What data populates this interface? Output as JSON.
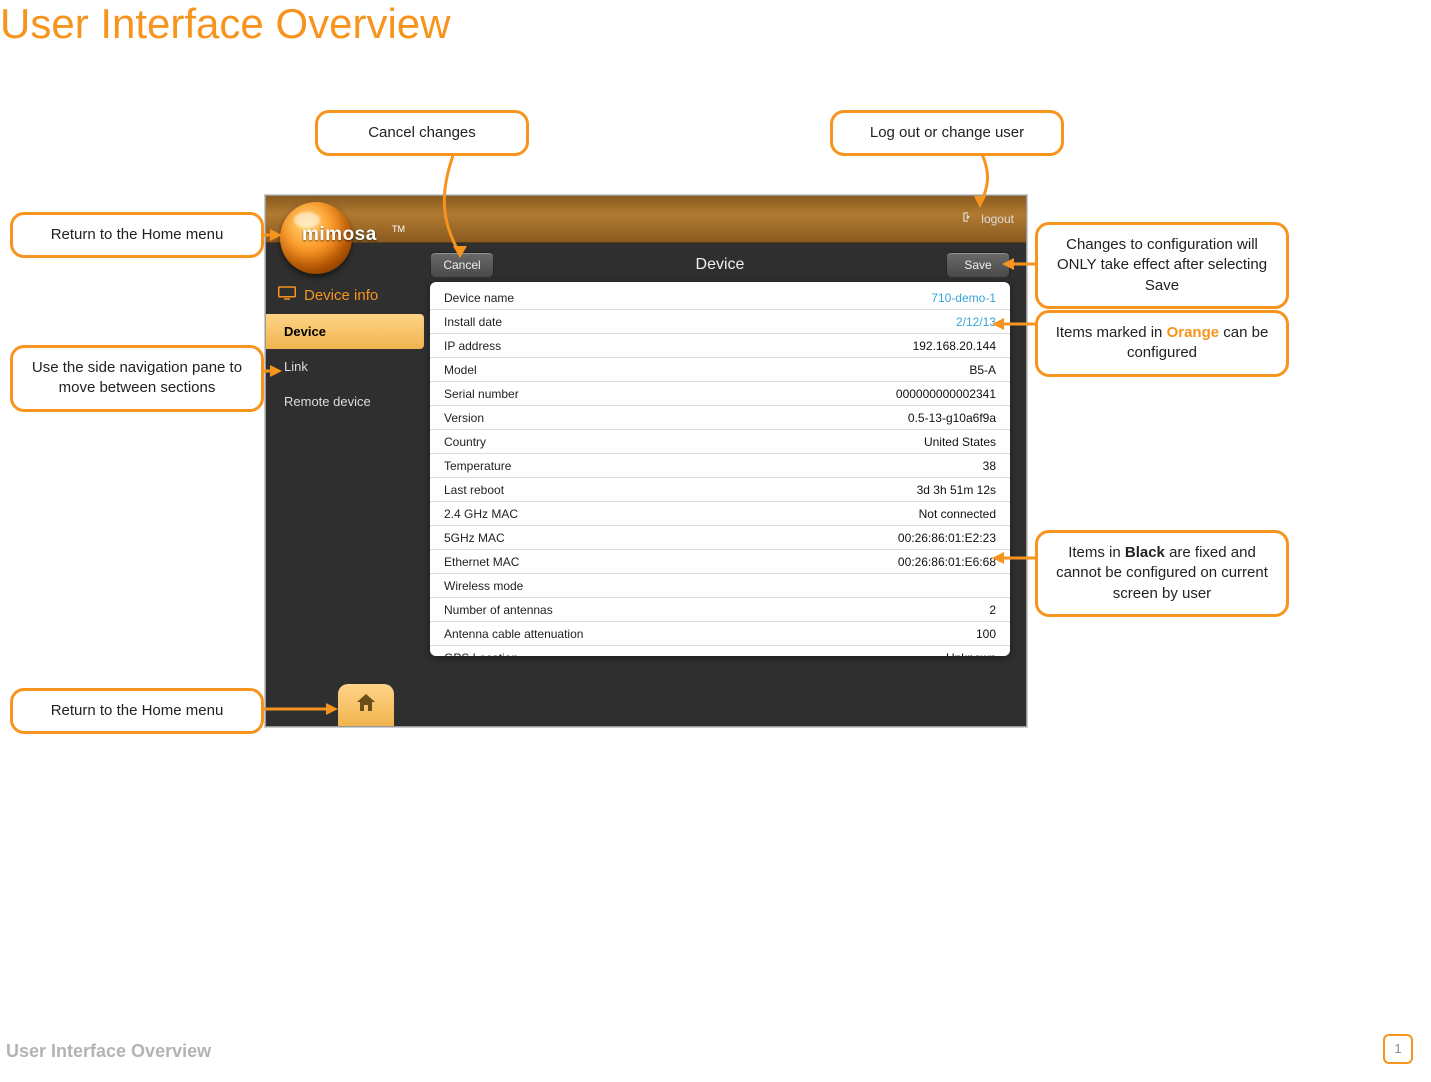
{
  "page": {
    "title": "User Interface Overview",
    "footer_title": "User Interface Overview",
    "page_number": "1"
  },
  "callouts": {
    "cancel": "Cancel changes",
    "logout": "Log out or change user",
    "home_top": "Return to the Home menu",
    "sidenav": "Use the side navigation pane to move between sections",
    "home_bottom": "Return to the Home menu",
    "save_prefix": "Changes to configuration will ONLY take effect after selecting Save",
    "orange_pref": "Items marked in ",
    "orange_word": "Orange",
    "orange_suf": " can be configured",
    "black_pref": "Items in ",
    "black_word": "Black",
    "black_suf": " are fixed and cannot be configured on current screen by user"
  },
  "app": {
    "brand": "mimosa",
    "brand_tm": "TM",
    "logout_label": "logout",
    "side_head": "Device info",
    "nav": {
      "device": "Device",
      "link": "Link",
      "remote": "Remote device"
    },
    "toolbar": {
      "cancel": "Cancel",
      "title": "Device",
      "save": "Save"
    },
    "rows": [
      {
        "label": "Device name",
        "value": "710-demo-1",
        "editable": true
      },
      {
        "label": "Install date",
        "value": "2/12/13",
        "editable": true
      },
      {
        "label": "IP address",
        "value": "192.168.20.144",
        "editable": false
      },
      {
        "label": "Model",
        "value": "B5-A",
        "editable": false
      },
      {
        "label": "Serial number",
        "value": "000000000002341",
        "editable": false
      },
      {
        "label": "Version",
        "value": "0.5-13-g10a6f9a",
        "editable": false
      },
      {
        "label": "Country",
        "value": "United States",
        "editable": false
      },
      {
        "label": "Temperature",
        "value": "38",
        "editable": false
      },
      {
        "label": "Last reboot",
        "value": "3d 3h 51m 12s",
        "editable": false
      },
      {
        "label": "2.4 GHz MAC",
        "value": "Not connected",
        "editable": false
      },
      {
        "label": "5GHz MAC",
        "value": "00:26:86:01:E2:23",
        "editable": false
      },
      {
        "label": "Ethernet MAC",
        "value": "00:26:86:01:E6:68",
        "editable": false
      },
      {
        "label": "Wireless mode",
        "value": "",
        "editable": false
      },
      {
        "label": "Number of antennas",
        "value": "2",
        "editable": false
      },
      {
        "label": "Antenna cable attenuation",
        "value": "100",
        "editable": false
      },
      {
        "label": "GPS Location",
        "value": "Unknown",
        "editable": false
      }
    ]
  }
}
